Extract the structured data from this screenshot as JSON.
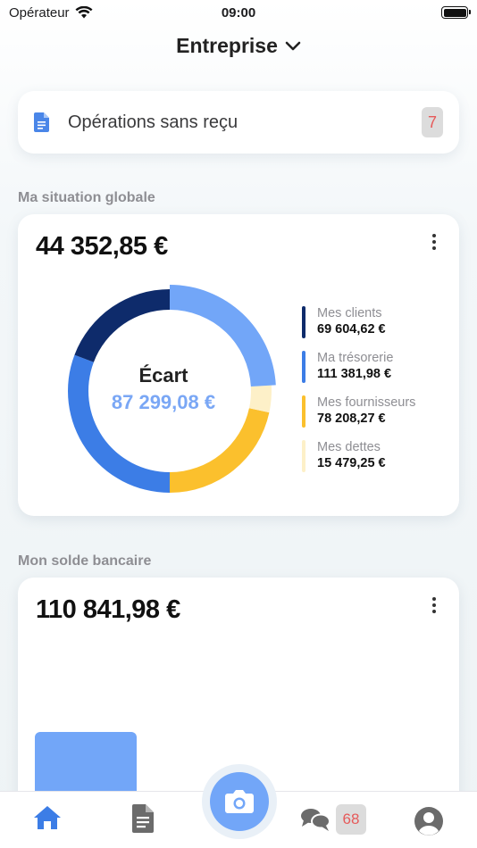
{
  "status_bar": {
    "carrier": "Opérateur",
    "time": "09:00"
  },
  "header": {
    "title": "Entreprise"
  },
  "receipts": {
    "label": "Opérations sans reçu",
    "count": "7"
  },
  "global": {
    "section_title": "Ma situation globale",
    "amount": "44 352,85 €",
    "center_label": "Écart",
    "center_value": "87 299,08 €",
    "legend": [
      {
        "name": "Mes clients",
        "value": "69 604,62 €",
        "color": "#0e2b6b"
      },
      {
        "name": "Ma trésorerie",
        "value": "111 381,98 €",
        "color": "#3c7de6"
      },
      {
        "name": "Mes fournisseurs",
        "value": "78 208,27 €",
        "color": "#fbc02d"
      },
      {
        "name": "Mes dettes",
        "value": "15 479,25 €",
        "color": "#fdf0c8"
      }
    ]
  },
  "bank": {
    "section_title": "Mon solde bancaire",
    "amount": "110 841,98 €",
    "bar_color": "#72a6f8"
  },
  "tabbar": {
    "items": [
      "home-icon",
      "document-icon",
      "camera-icon",
      "chat-icon",
      "profile-icon"
    ],
    "chat_count": "68",
    "active_color": "#3c7de6"
  }
}
